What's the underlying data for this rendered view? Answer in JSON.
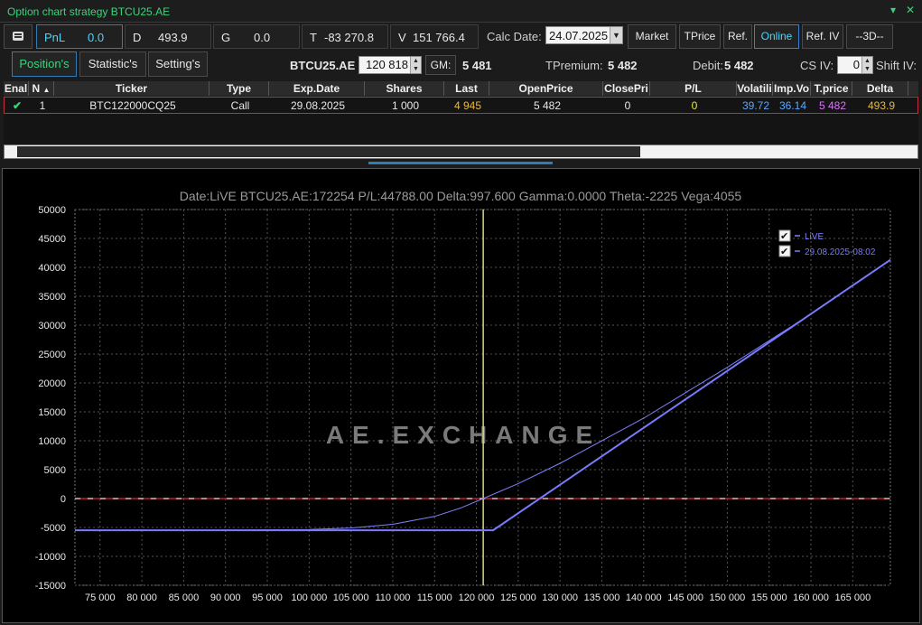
{
  "window": {
    "title": "Option chart strategy BTCU25.AE",
    "pin_icon": "▾",
    "close_icon": "✕"
  },
  "toolbar": {
    "pnl_label": "PnL",
    "pnl_value": "0.0",
    "d_label": "D",
    "d_value": "493.9",
    "g_label": "G",
    "g_value": "0.0",
    "t_label": "T",
    "t_value": "-83 270.8",
    "v_label": "V",
    "v_value": "151 766.4",
    "calc_date_label": "Calc Date:",
    "calc_date_value": "24.07.2025",
    "buttons": {
      "market": "Market",
      "tprice": "TPrice",
      "ref": "Ref.",
      "online": "Online",
      "ref_iv": "Ref. IV",
      "three_d": "--3D--"
    }
  },
  "tabs": {
    "positions": "Position's",
    "statistics": "Statistic's",
    "settings": "Setting's"
  },
  "summary": {
    "symbol": "BTCU25.AE",
    "price": "120 818",
    "gm_label": "GM:",
    "gm_value": "5 481",
    "tpremium_label": "TPremium:",
    "tpremium_value": "5 482",
    "debit_label": "Debit:",
    "debit_value": "5 482",
    "cs_iv_label": "CS IV:",
    "cs_iv_value": "0",
    "shift_iv_label": "Shift IV:"
  },
  "table": {
    "headers": {
      "enabled": "Enal",
      "n": "N",
      "ticker": "Ticker",
      "type": "Type",
      "exp_date": "Exp.Date",
      "shares": "Shares",
      "last": "Last",
      "open_price": "OpenPrice",
      "close_price": "ClosePri",
      "pl": "P/L",
      "volatility": "Volatili",
      "imp_vol": "Imp.Vo",
      "t_price": "T.price",
      "delta": "Delta"
    },
    "rows": [
      {
        "enabled": "✔",
        "n": "1",
        "ticker": "BTC122000CQ25",
        "type": "Call",
        "exp_date": "29.08.2025",
        "shares": "1 000",
        "last": "4 945",
        "open_price": "5 482",
        "close_price": "0",
        "pl": "0",
        "volatility": "39.72",
        "imp_vol": "36.14",
        "t_price": "5 482",
        "delta": "493.9"
      }
    ]
  },
  "chart_data": {
    "type": "line",
    "title": "Date:LiVE  BTCU25.AE:172254  P/L:44788.00  Delta:997.600  Gamma:0.0000  Theta:-2225  Vega:4055",
    "watermark": "AE.EXCHANGE",
    "xlabel": "",
    "ylabel": "",
    "xlim": [
      72000,
      169500
    ],
    "ylim": [
      -15000,
      50000
    ],
    "xticks": [
      75000,
      80000,
      85000,
      90000,
      95000,
      100000,
      105000,
      110000,
      115000,
      120000,
      125000,
      130000,
      135000,
      140000,
      145000,
      150000,
      155000,
      160000,
      165000
    ],
    "xtick_labels": [
      "75 000",
      "80 000",
      "85 000",
      "90 000",
      "95 000",
      "100 000",
      "105 000",
      "110 000",
      "115 000",
      "120 000",
      "125 000",
      "130 000",
      "135 000",
      "140 000",
      "145 000",
      "150 000",
      "155 000",
      "160 000",
      "165 000"
    ],
    "yticks": [
      50000,
      45000,
      40000,
      35000,
      30000,
      25000,
      20000,
      15000,
      10000,
      5000,
      0,
      -5000,
      -10000,
      -15000
    ],
    "ytick_labels": [
      "50000",
      "45000",
      "40000",
      "35000",
      "30000",
      "25000",
      "20000",
      "15000",
      "10000",
      "5000",
      "0",
      "-5000",
      "-10000",
      "-15000"
    ],
    "current_price": 120818,
    "zero_line": 0,
    "grid": true,
    "legend_position": "top-right",
    "series": [
      {
        "name": "LiVE",
        "x": [
          72000,
          90000,
          100000,
          105000,
          110000,
          115000,
          118000,
          120818,
          125000,
          130000,
          140000,
          150000,
          160000,
          169500
        ],
        "y": [
          -5470,
          -5470,
          -5350,
          -5100,
          -4450,
          -3100,
          -1700,
          0,
          2600,
          6100,
          13900,
          22700,
          31900,
          41300
        ],
        "color": "#8080ff"
      },
      {
        "name": "29.08.2025-08:02",
        "x": [
          72000,
          122000,
          169500
        ],
        "y": [
          -5482,
          -5482,
          41300
        ],
        "color": "#7a7aff"
      }
    ]
  }
}
